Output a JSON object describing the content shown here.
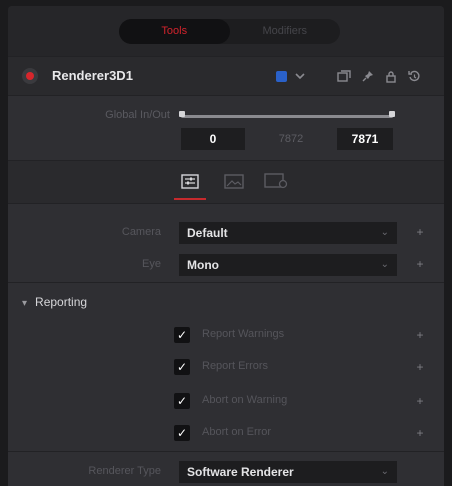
{
  "tabs": [
    {
      "label": "Tools",
      "active": true
    },
    {
      "label": "Modifiers",
      "active": false
    }
  ],
  "node": {
    "name": "Renderer3D1",
    "color_swatch": "#2a61c9",
    "header_icons": [
      "color-dropdown-icon",
      "view-icon",
      "pin-icon",
      "lock-icon",
      "reset-icon"
    ]
  },
  "global_in_out": {
    "label": "Global In/Out",
    "in_value": "0",
    "mid_value": "7872",
    "out_value": "7871"
  },
  "inspector_tabs": [
    "controls-icon",
    "image-icon",
    "settings-icon"
  ],
  "camera": {
    "label": "Camera",
    "value": "Default"
  },
  "eye": {
    "label": "Eye",
    "value": "Mono"
  },
  "reporting": {
    "title": "Reporting",
    "items": [
      {
        "label": "Report Warnings",
        "checked": true
      },
      {
        "label": "Report Errors",
        "checked": true
      },
      {
        "label": "Abort on Warning",
        "checked": true
      },
      {
        "label": "Abort on Error",
        "checked": true
      }
    ]
  },
  "renderer_type": {
    "label": "Renderer Type",
    "value": "Software Renderer"
  },
  "colors": {
    "accent": "#d2232c",
    "swatch": "#2a61c9",
    "panel": "#2f2f33"
  }
}
